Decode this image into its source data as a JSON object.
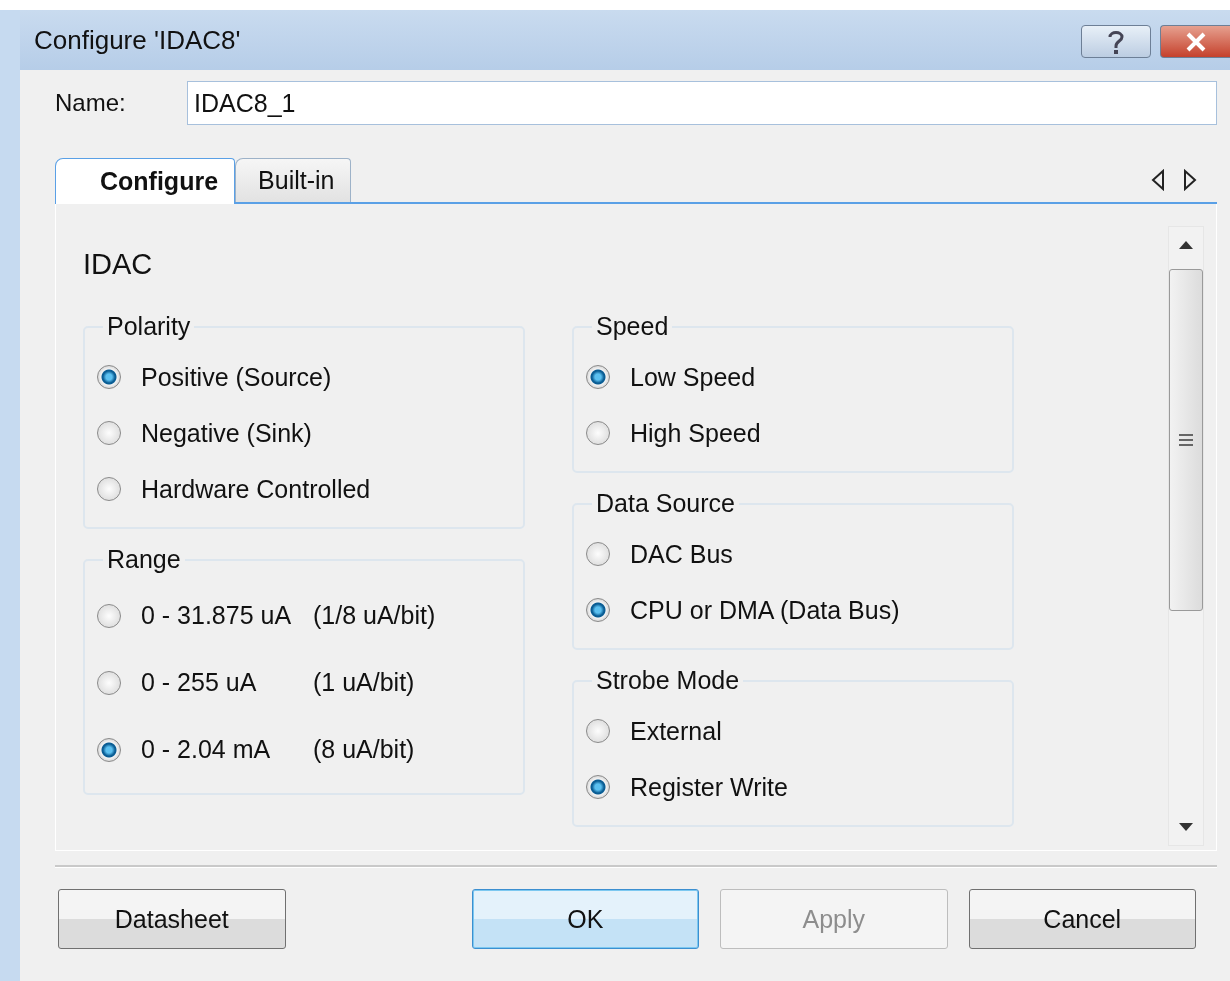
{
  "window": {
    "title": "Configure 'IDAC8'"
  },
  "name_field": {
    "label": "Name:",
    "value": "IDAC8_1"
  },
  "tabs": [
    {
      "label": "Configure",
      "selected": true
    },
    {
      "label": "Built-in",
      "selected": false
    }
  ],
  "section_title": "IDAC",
  "columns": [
    {
      "groups": [
        {
          "title": "Polarity",
          "options": [
            {
              "label": "Positive (Source)",
              "selected": true
            },
            {
              "label": "Negative (Sink)",
              "selected": false
            },
            {
              "label": "Hardware Controlled",
              "selected": false
            }
          ]
        },
        {
          "title": "Range",
          "options": [
            {
              "label": "0 - 31.875 uA",
              "note": "(1/8 uA/bit)",
              "selected": false
            },
            {
              "label": "0 - 255 uA",
              "note": "(1 uA/bit)",
              "selected": false
            },
            {
              "label": "0 - 2.04 mA",
              "note": "(8 uA/bit)",
              "selected": true
            }
          ]
        }
      ]
    },
    {
      "groups": [
        {
          "title": "Speed",
          "options": [
            {
              "label": "Low Speed",
              "selected": true
            },
            {
              "label": "High Speed",
              "selected": false
            }
          ]
        },
        {
          "title": "Data Source",
          "options": [
            {
              "label": "DAC Bus",
              "selected": false
            },
            {
              "label": "CPU or DMA (Data Bus)",
              "selected": true
            }
          ]
        },
        {
          "title": "Strobe Mode",
          "options": [
            {
              "label": "External",
              "selected": false
            },
            {
              "label": "Register Write",
              "selected": true
            }
          ]
        }
      ]
    }
  ],
  "buttons": [
    {
      "label": "Datasheet",
      "kind": "normal"
    },
    {
      "label": "OK",
      "kind": "default"
    },
    {
      "label": "Apply",
      "kind": "disabled"
    },
    {
      "label": "Cancel",
      "kind": "normal"
    }
  ]
}
